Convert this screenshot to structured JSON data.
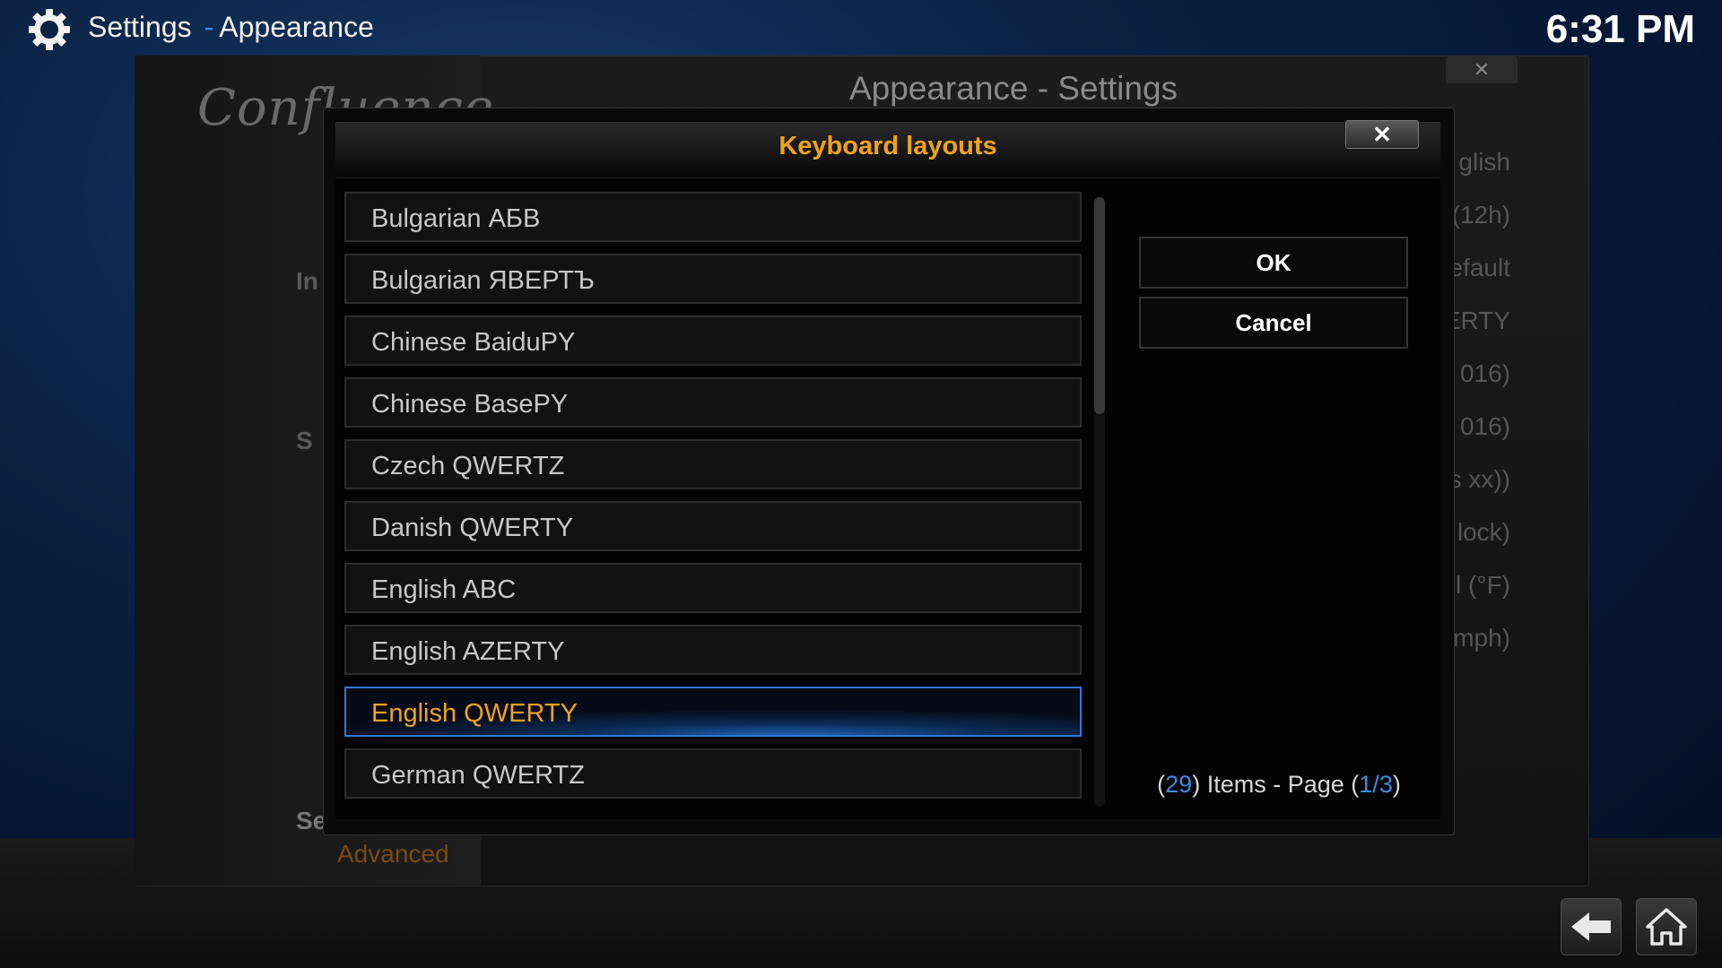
{
  "topbar": {
    "section": "Settings",
    "subsection": "Appearance",
    "separator": "-",
    "clock": "6:31 PM"
  },
  "background": {
    "logo": "Confluence",
    "window_title": "Appearance - Settings",
    "sidebar_items": [
      "In",
      "S"
    ],
    "settings_level_label": "Settings level",
    "settings_level_value": "Advanced",
    "values": [
      "glish",
      "(12h)",
      "efault",
      "ERTY",
      "016)",
      "016)",
      "s xx))",
      "lock)",
      "l (°F)",
      "mph)"
    ]
  },
  "dialog": {
    "title": "Keyboard layouts",
    "close_glyph": "✕",
    "items": [
      {
        "label": "Bulgarian АБВ",
        "selected": false
      },
      {
        "label": "Bulgarian ЯВЕРТЪ",
        "selected": false
      },
      {
        "label": "Chinese BaiduPY",
        "selected": false
      },
      {
        "label": "Chinese BasePY",
        "selected": false
      },
      {
        "label": "Czech QWERTZ",
        "selected": false
      },
      {
        "label": "Danish QWERTY",
        "selected": false
      },
      {
        "label": "English ABC",
        "selected": false
      },
      {
        "label": "English AZERTY",
        "selected": false
      },
      {
        "label": "English QWERTY",
        "selected": true
      },
      {
        "label": "German QWERTZ",
        "selected": false
      }
    ],
    "ok_label": "OK",
    "cancel_label": "Cancel",
    "item_count": "29",
    "items_text": "Items - Page",
    "page_current": "1",
    "page_total": "3"
  },
  "colors": {
    "accent_orange": "#f0a318",
    "accent_blue": "#3b8ee0",
    "selection_border": "#2f78d6"
  },
  "icons": {
    "settings": "gear-icon",
    "back": "back-arrow-icon",
    "home": "home-icon",
    "close": "close-icon"
  }
}
